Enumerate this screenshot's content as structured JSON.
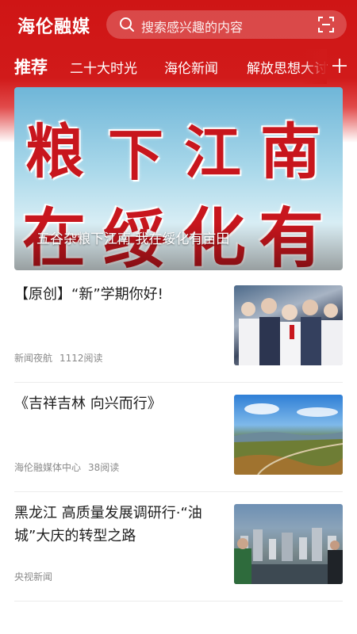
{
  "app": {
    "title": "海伦融媒",
    "search_placeholder": "搜索感兴趣的内容",
    "accent_color": "#d11a1a",
    "icons": {
      "search": "search-icon",
      "scan": "scan-icon",
      "more_tabs": "plus-icon"
    }
  },
  "tabs": [
    {
      "label": "推荐",
      "active": true
    },
    {
      "label": "二十大时光",
      "active": false
    },
    {
      "label": "海伦新闻",
      "active": false
    },
    {
      "label": "解放思想大讨",
      "active": false
    }
  ],
  "banner": {
    "art_text_line1": [
      "粮",
      "下",
      "江",
      "南"
    ],
    "art_text_line2": [
      "在",
      "绥",
      "化",
      "有"
    ],
    "caption": "五谷杂粮下江南 我在绥化有亩田"
  },
  "news": [
    {
      "title": "【原创】“新”学期你好!",
      "source": "新闻夜航",
      "reads": "1112阅读",
      "thumbnail": "students-in-uniform-photo"
    },
    {
      "title": "《吉祥吉林 向兴而行》",
      "source": "海伦融媒体中心",
      "reads": "38阅读",
      "thumbnail": "landscape-photo"
    },
    {
      "title": "黑龙江 高质量发展调研行·“油城”大庆的转型之路",
      "source": "央视新闻",
      "reads": "",
      "thumbnail": "city-aerial-photo"
    }
  ]
}
